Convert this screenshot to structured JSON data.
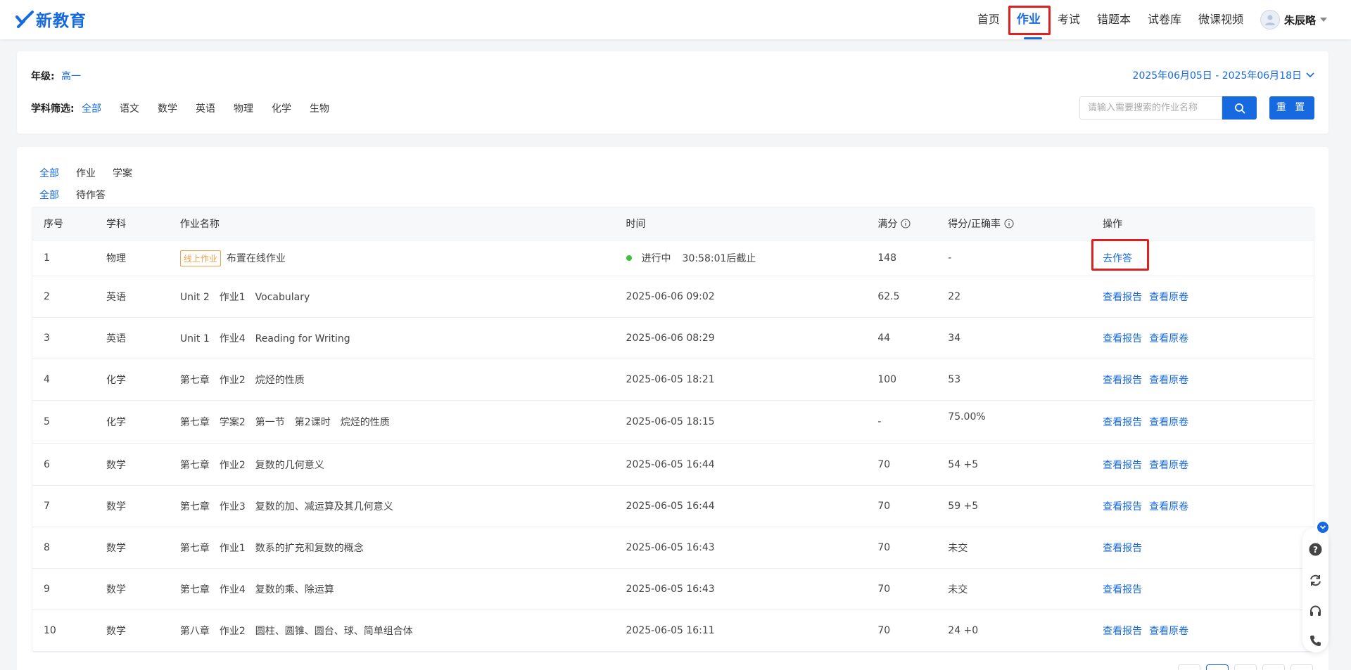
{
  "logo": {
    "text": "新教育",
    "icon": "logo-check-icon",
    "color": "#1769e0"
  },
  "nav": {
    "items": [
      "首页",
      "作业",
      "考试",
      "错题本",
      "试卷库",
      "微课视频"
    ],
    "active_index": 1,
    "user_name": "朱辰略"
  },
  "filters": {
    "grade_label": "年级:",
    "grade_value": "高一",
    "date_range": "2025年06月05日 - 2025年06月18日",
    "subject_label": "学科筛选:",
    "subjects": [
      "全部",
      "语文",
      "数学",
      "英语",
      "物理",
      "化学",
      "生物"
    ],
    "active_subject": "全部",
    "search_placeholder": "请输入需要搜索的作业名称",
    "reset_label": "重 置"
  },
  "type_tabs": [
    "全部",
    "作业",
    "学案"
  ],
  "status_tabs": [
    "全部",
    "待作答"
  ],
  "table": {
    "headers": [
      "序号",
      "学科",
      "作业名称",
      "时间",
      "满分",
      "得分/正确率",
      "操作"
    ],
    "rows": [
      {
        "no": "1",
        "subject": "物理",
        "tag": "线上作业",
        "name": "布置在线作业",
        "status": "进行中",
        "time": "30:58:01后截止",
        "full": "148",
        "score": "-",
        "actions": [
          "去作答"
        ]
      },
      {
        "no": "2",
        "subject": "英语",
        "name": "Unit 2　作业1　Vocabulary",
        "time": "2025-06-06 09:02",
        "full": "62.5",
        "score": "22",
        "actions": [
          "查看报告",
          "查看原卷"
        ]
      },
      {
        "no": "3",
        "subject": "英语",
        "name": "Unit 1　作业4　Reading for Writing",
        "time": "2025-06-06 08:29",
        "full": "44",
        "score": "34",
        "actions": [
          "查看报告",
          "查看原卷"
        ]
      },
      {
        "no": "4",
        "subject": "化学",
        "name": "第七章　作业2　烷烃的性质",
        "time": "2025-06-05 18:21",
        "full": "100",
        "score": "53",
        "actions": [
          "查看报告",
          "查看原卷"
        ]
      },
      {
        "no": "5",
        "subject": "化学",
        "name": "第七章　学案2　第一节　第2课时　烷烃的性质",
        "time": "2025-06-05 18:15",
        "full": "-",
        "score": "75.00%",
        "actions": [
          "查看报告",
          "查看原卷"
        ]
      },
      {
        "no": "6",
        "subject": "数学",
        "name": "第七章　作业2　复数的几何意义",
        "time": "2025-06-05 16:44",
        "full": "70",
        "score": "54 +5",
        "actions": [
          "查看报告",
          "查看原卷"
        ]
      },
      {
        "no": "7",
        "subject": "数学",
        "name": "第七章　作业3　复数的加、减运算及其几何意义",
        "time": "2025-06-05 16:44",
        "full": "70",
        "score": "59 +5",
        "actions": [
          "查看报告",
          "查看原卷"
        ]
      },
      {
        "no": "8",
        "subject": "数学",
        "name": "第七章　作业1　数系的扩充和复数的概念",
        "time": "2025-06-05 16:43",
        "full": "70",
        "score": "未交",
        "actions": [
          "查看报告"
        ]
      },
      {
        "no": "9",
        "subject": "数学",
        "name": "第七章　作业4　复数的乘、除运算",
        "time": "2025-06-05 16:43",
        "full": "70",
        "score": "未交",
        "actions": [
          "查看报告"
        ]
      },
      {
        "no": "10",
        "subject": "数学",
        "name": "第八章　作业2　圆柱、圆锥、圆台、球、简单组合体",
        "time": "2025-06-05 16:11",
        "full": "70",
        "score": "24 +0",
        "actions": [
          "查看报告",
          "查看原卷"
        ]
      }
    ]
  },
  "float_tools": [
    "help-icon",
    "refresh-icon",
    "headset-icon",
    "phone-icon"
  ],
  "colors": {
    "accent": "#1769e0",
    "highlight": "#e02020",
    "tag": "#f0a04b",
    "status_green": "#3cc13b"
  }
}
